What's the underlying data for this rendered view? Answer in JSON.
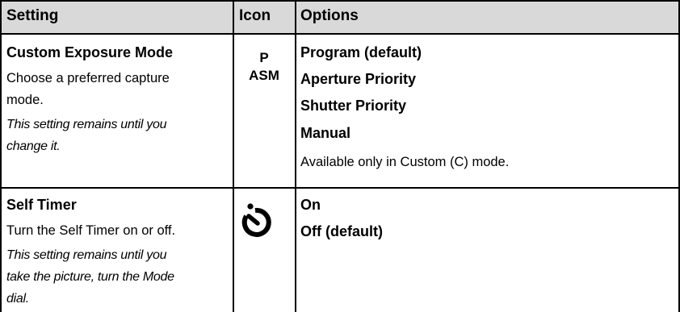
{
  "table": {
    "headers": {
      "setting": "Setting",
      "icon": "Icon",
      "options": "Options"
    },
    "rows": [
      {
        "title": "Custom Exposure Mode",
        "desc_lines": [
          "Choose a preferred capture",
          "mode."
        ],
        "note_lines": [
          "This setting remains until you",
          "change it."
        ],
        "icon_lines": [
          "P",
          "ASM"
        ],
        "options": [
          "Program (default)",
          "Aperture Priority",
          "Shutter Priority",
          "Manual"
        ],
        "options_note": "Available only in Custom (C) mode."
      },
      {
        "title": "Self Timer",
        "desc_lines": [
          "Turn the Self Timer on or off."
        ],
        "note_lines": [
          "This setting remains until you",
          "take the picture, turn the Mode",
          "dial."
        ],
        "icon": "self-timer-icon",
        "options": [
          "On",
          "Off (default)"
        ]
      }
    ]
  }
}
